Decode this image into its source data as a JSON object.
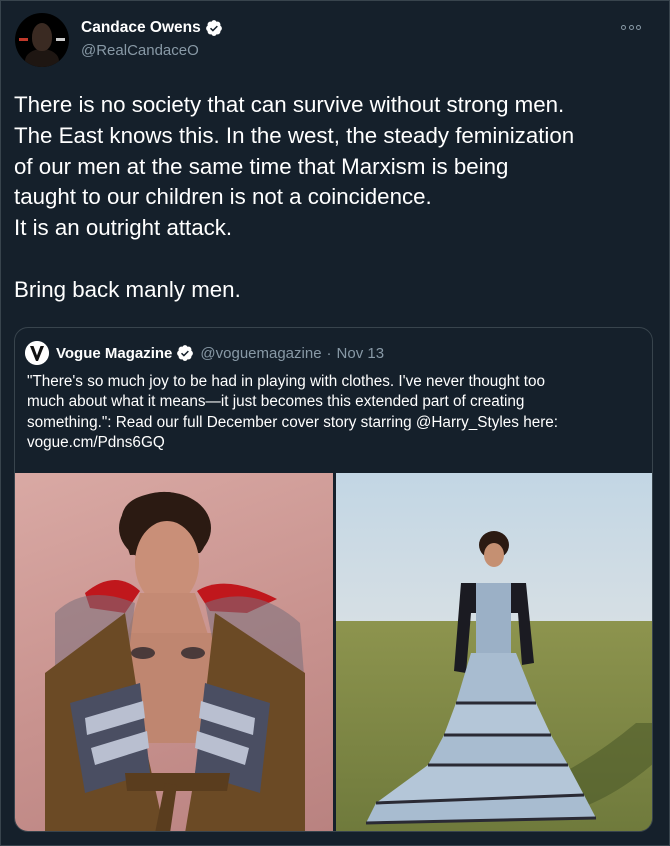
{
  "tweet": {
    "author_name": "Candace Owens",
    "author_handle": "@RealCandaceO",
    "text_lines": [
      "There is no society that can survive without strong men.",
      "The East knows this. In the west, the steady feminization",
      "of our men at the same time that Marxism is being",
      "taught to our children is not a coincidence.",
      "It is an outright attack.",
      "",
      "Bring back manly men."
    ]
  },
  "quote": {
    "author_name": "Vogue Magazine",
    "author_handle": "@voguemagazine",
    "separator": "·",
    "date": "Nov 13",
    "text_lines": [
      "\"There's so much joy to be had in playing with clothes. I've never thought too",
      "much about what it means—it just becomes this extended part of creating",
      "something.\": Read our full December cover story starring @Harry_Styles here:",
      "vogue.cm/Pdns6GQ"
    ]
  },
  "icons": {
    "verified": "verified-badge-icon",
    "more": "more-options-icon",
    "vogue_logo": "vogue-v-logo"
  },
  "colors": {
    "background": "#15202b",
    "border": "#38444d",
    "secondary_text": "#8899a6",
    "primary_text": "#ffffff"
  }
}
